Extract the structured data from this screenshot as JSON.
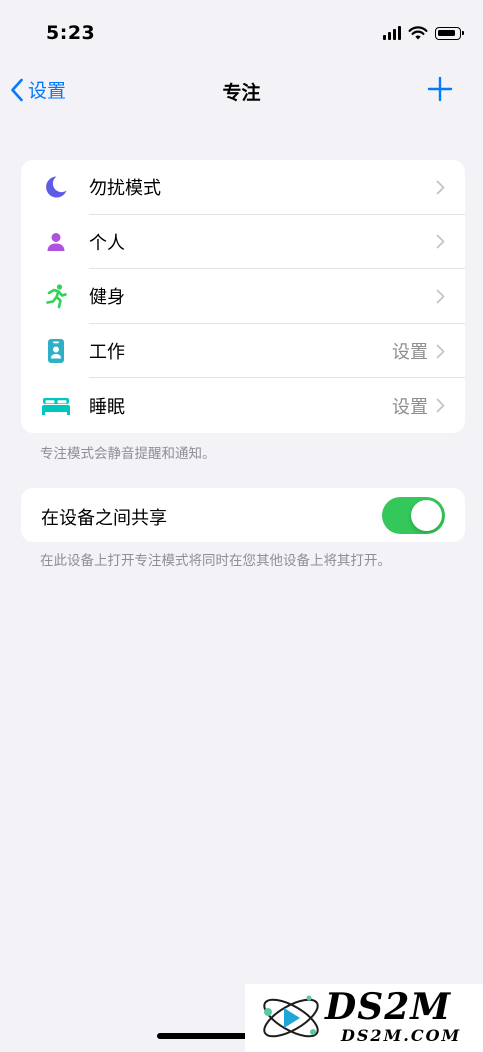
{
  "status_bar": {
    "time": "5:23"
  },
  "nav": {
    "back_label": "设置",
    "title": "专注"
  },
  "focus_modes": [
    {
      "label": "勿扰模式",
      "icon": "moon-icon",
      "detail": "",
      "color": "#5e5ce6"
    },
    {
      "label": "个人",
      "icon": "person-icon",
      "detail": "",
      "color": "#af52de"
    },
    {
      "label": "健身",
      "icon": "running-icon",
      "detail": "",
      "color": "#30d158"
    },
    {
      "label": "工作",
      "icon": "id-badge-icon",
      "detail": "设置",
      "color": "#30b0c7"
    },
    {
      "label": "睡眠",
      "icon": "bed-icon",
      "detail": "设置",
      "color": "#00c7be"
    }
  ],
  "focus_footnote": "专注模式会静音提醒和通知。",
  "share": {
    "label": "在设备之间共享",
    "enabled": true,
    "toggle_color": "#34c759"
  },
  "share_footnote": "在此设备上打开专注模式将同时在您其他设备上将其打开。",
  "watermark": {
    "title": "DS2M",
    "subtitle": "DS2M.COM"
  },
  "colors": {
    "accent": "#007aff",
    "background": "#f2f2f7",
    "secondary_text": "#8e8e93"
  }
}
